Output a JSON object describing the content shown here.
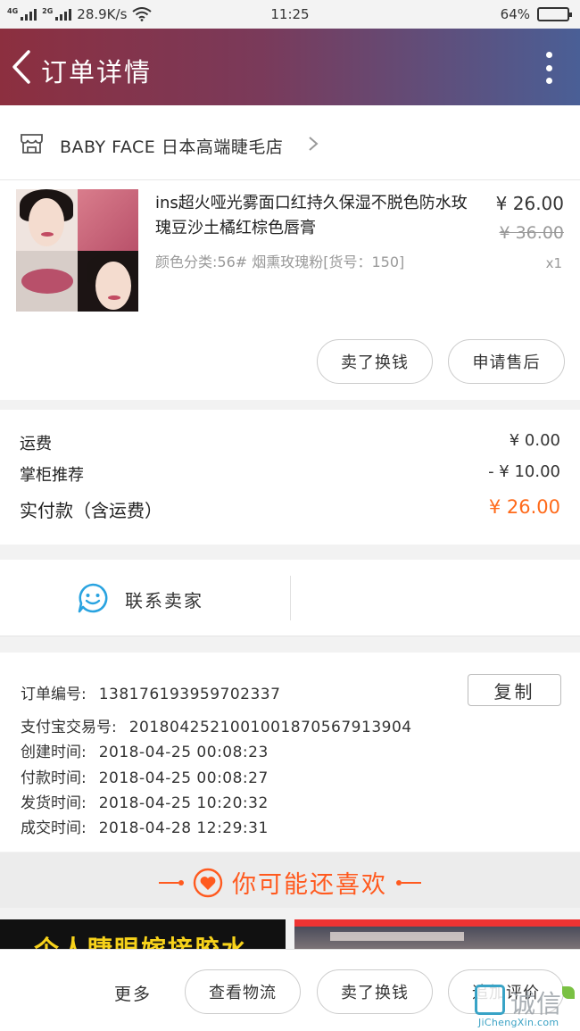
{
  "status_bar": {
    "net_1": "4G",
    "net_2": "2G",
    "speed": "28.9K/s",
    "time": "11:25",
    "battery": "64%",
    "battery_level": 0.64
  },
  "header": {
    "title": "订单详情",
    "back_icon": "chevron-left-icon",
    "more_icon": "more-vertical-icon"
  },
  "shop": {
    "name": "BABY FACE 日本高端睫毛店",
    "icon": "store-icon"
  },
  "product": {
    "title": "ins超火哑光雾面口红持久保湿不脱色防水玫瑰豆沙土橘红棕色唇膏",
    "sku": "颜色分类:56# 烟熏玫瑰粉[货号：150]",
    "price": "¥ 26.00",
    "original_price": "¥ 36.00",
    "quantity": "x1",
    "actions": {
      "resell": "卖了换钱",
      "after_sale": "申请售后"
    }
  },
  "fees": {
    "shipping_label": "运费",
    "shipping_value": "¥ 0.00",
    "discount_label": "掌柜推荐",
    "discount_value": "- ¥ 10.00",
    "total_label": "实付款（含运费）",
    "total_value": "¥ 26.00"
  },
  "contact": {
    "label": "联系卖家",
    "icon": "chat-smile-icon"
  },
  "order_info": {
    "copy_button": "复制",
    "rows": [
      {
        "key": "订单编号:",
        "value": "138176193959702337"
      },
      {
        "key": "支付宝交易号:",
        "value": "2018042521001001870567913904"
      },
      {
        "key": "创建时间:",
        "value": "2018-04-25 00:08:23"
      },
      {
        "key": "付款时间:",
        "value": "2018-04-25 00:08:27"
      },
      {
        "key": "发货时间:",
        "value": "2018-04-25 10:20:32"
      },
      {
        "key": "成交时间:",
        "value": "2018-04-28 12:29:31"
      }
    ]
  },
  "recommend": {
    "title": "你可能还喜欢",
    "item_1_banner": "个人睫眼嫁接胶水"
  },
  "bottom_bar": {
    "more": "更多",
    "logistics": "查看物流",
    "resell": "卖了换钱",
    "review": "追加评价"
  },
  "watermark": {
    "text": "诚信",
    "site": "JiChengXin.com"
  },
  "colors": {
    "accent": "#ff5a1f",
    "header_start": "#8c2f3f",
    "header_end": "#4a5f96",
    "contact_icon": "#29a3e0"
  }
}
